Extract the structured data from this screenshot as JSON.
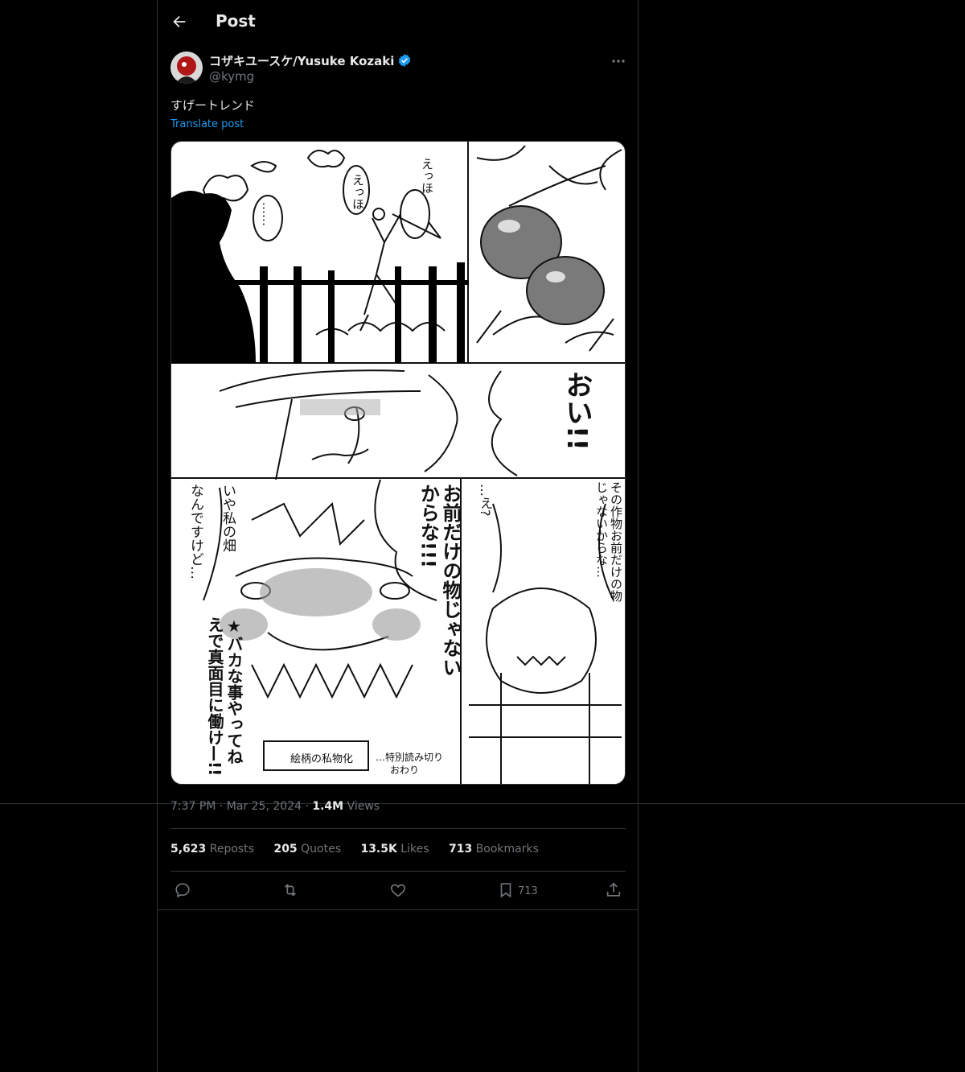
{
  "header": {
    "title": "Post"
  },
  "author": {
    "name": "コザキユースケ/Yusuke Kozaki",
    "handle": "@kymg"
  },
  "post": {
    "text": "すげートレンド",
    "translate_label": "Translate post",
    "time": "7:37 PM",
    "date": "Mar 25, 2024",
    "views_value": "1.4M",
    "views_label": "Views"
  },
  "stats": {
    "reposts_value": "5,623",
    "reposts_label": "Reposts",
    "quotes_value": "205",
    "quotes_label": "Quotes",
    "likes_value": "13.5K",
    "likes_label": "Likes",
    "bookmarks_value": "713",
    "bookmarks_label": "Bookmarks"
  },
  "actions": {
    "bookmark_count": "713"
  },
  "comic_text": {
    "p1_a": "えっほ",
    "p1_b": "えっほ",
    "p1_c": "……",
    "p3_shout": "おい!!",
    "p4_a": "いや私の畑",
    "p4_b": "なんですけど…",
    "p4_c": "お前だけの物じゃないからな!!!",
    "p4_d": "★バカな事やってねえで真面目に働け—!!",
    "p4_tag": "絵柄の私物化",
    "p4_end1": "…特別読み切り",
    "p4_end2": "おわり",
    "p5_a": "…え?",
    "p5_b": "その作物お前だけの物じゃないからな…"
  },
  "icons": [
    "back-arrow-icon",
    "verified-badge-icon",
    "more-icon",
    "reply-icon",
    "repost-icon",
    "like-icon",
    "bookmark-icon",
    "share-icon"
  ],
  "colors": {
    "accent": "#1d9bf0",
    "muted": "#71767b",
    "border": "#2f3336"
  }
}
